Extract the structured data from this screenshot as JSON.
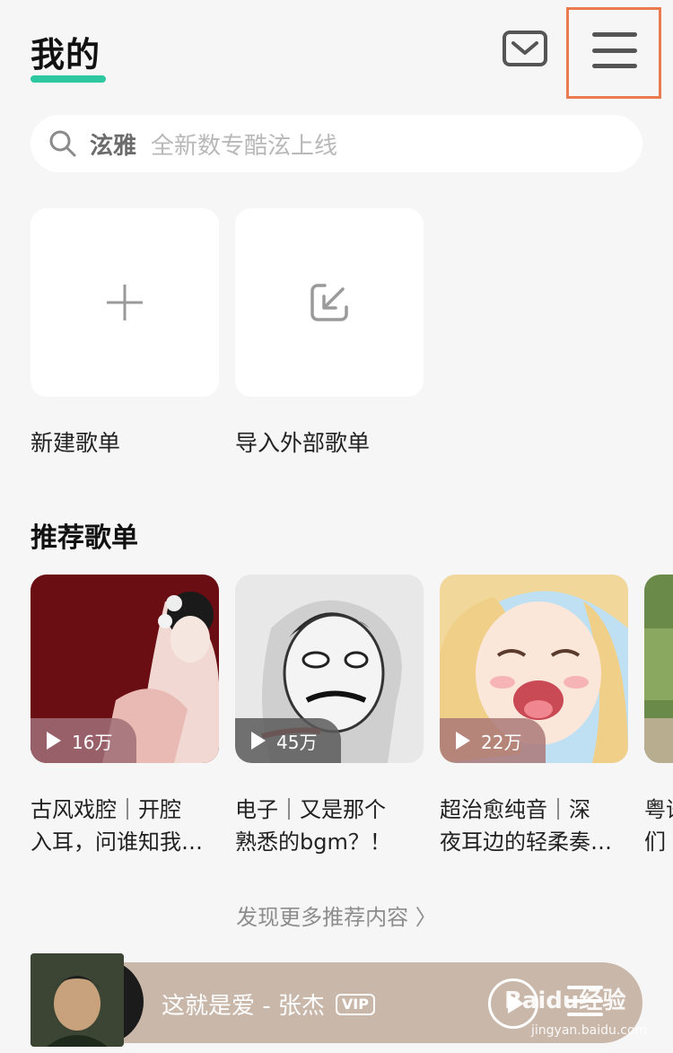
{
  "header": {
    "title": "我的"
  },
  "search": {
    "keyword": "泫雅",
    "hint": "全新数专酷泫上线"
  },
  "tiles": [
    {
      "label": "新建歌单",
      "icon": "plus-icon"
    },
    {
      "label": "导入外部歌单",
      "icon": "import-icon"
    }
  ],
  "recommend": {
    "title": "推荐歌单",
    "cards": [
      {
        "plays": "16万",
        "line1": "古风戏腔｜开腔",
        "line2": "入耳，问谁知我…"
      },
      {
        "plays": "45万",
        "line1": "电子｜又是那个",
        "line2": "熟悉的bgm？！"
      },
      {
        "plays": "22万",
        "line1": "超治愈纯音｜深",
        "line2": "夜耳边的轻柔奏…"
      },
      {
        "line1": "粤语",
        "line2": "们"
      }
    ]
  },
  "more": "发现更多推荐内容 〉",
  "player": {
    "song": "这就是爱 - 张杰",
    "vip": "VIP"
  },
  "watermark": {
    "brand": "Baidu经验",
    "url": "jingyan.baidu.com"
  },
  "colors": {
    "accent": "#2ec8a0",
    "highlight_box": "#ea7a50",
    "player_bg": "#c9b7a9"
  }
}
